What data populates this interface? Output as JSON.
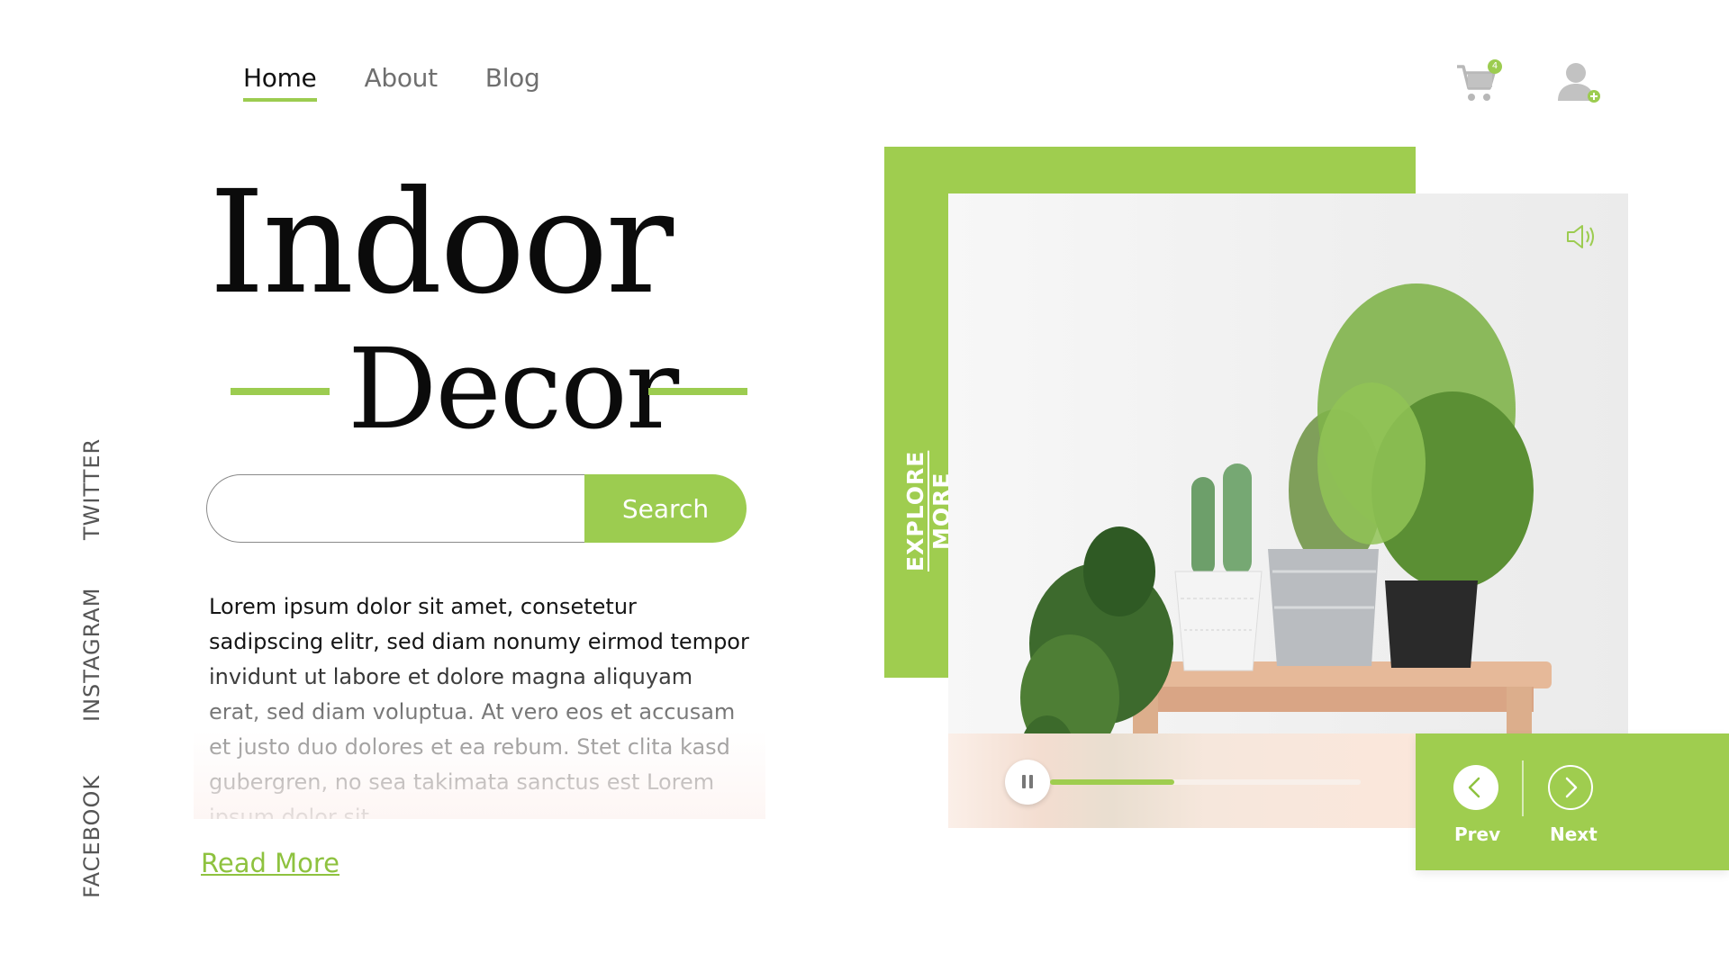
{
  "nav": {
    "items": [
      {
        "label": "Home",
        "active": true
      },
      {
        "label": "About",
        "active": false
      },
      {
        "label": "Blog",
        "active": false
      }
    ]
  },
  "header": {
    "cart_icon": "shopping-cart-icon",
    "cart_count": "4",
    "user_icon": "user-add-icon"
  },
  "hero": {
    "title_line1": "Indoor",
    "title_line2": "Decor"
  },
  "search": {
    "value": "",
    "button_label": "Search"
  },
  "description": "Lorem ipsum dolor sit amet, consetetur sadipscing elitr, sed diam nonumy eirmod tempor invidunt ut labore et dolore magna aliquyam erat, sed diam voluptua. At vero eos et accusam et justo duo dolores et ea rebum. Stet clita kasd gubergren, no sea takimata sanctus est Lorem ipsum dolor sit",
  "read_more_label": "Read More",
  "social": {
    "twitter": "TWITTER",
    "instagram": "INSTAGRAM",
    "facebook": "FACEBOOK"
  },
  "media": {
    "explore_label": "EXPLORE MORE",
    "speaker_icon": "speaker-icon",
    "pause_icon": "pause-icon",
    "progress_fraction": 0.4
  },
  "carousel": {
    "prev_label": "Prev",
    "next_label": "Next",
    "prev_icon": "chevron-left-icon",
    "next_icon": "chevron-right-icon"
  },
  "colors": {
    "accent": "#9ccc50",
    "text": "#111111",
    "muted": "#6f6f6f"
  }
}
